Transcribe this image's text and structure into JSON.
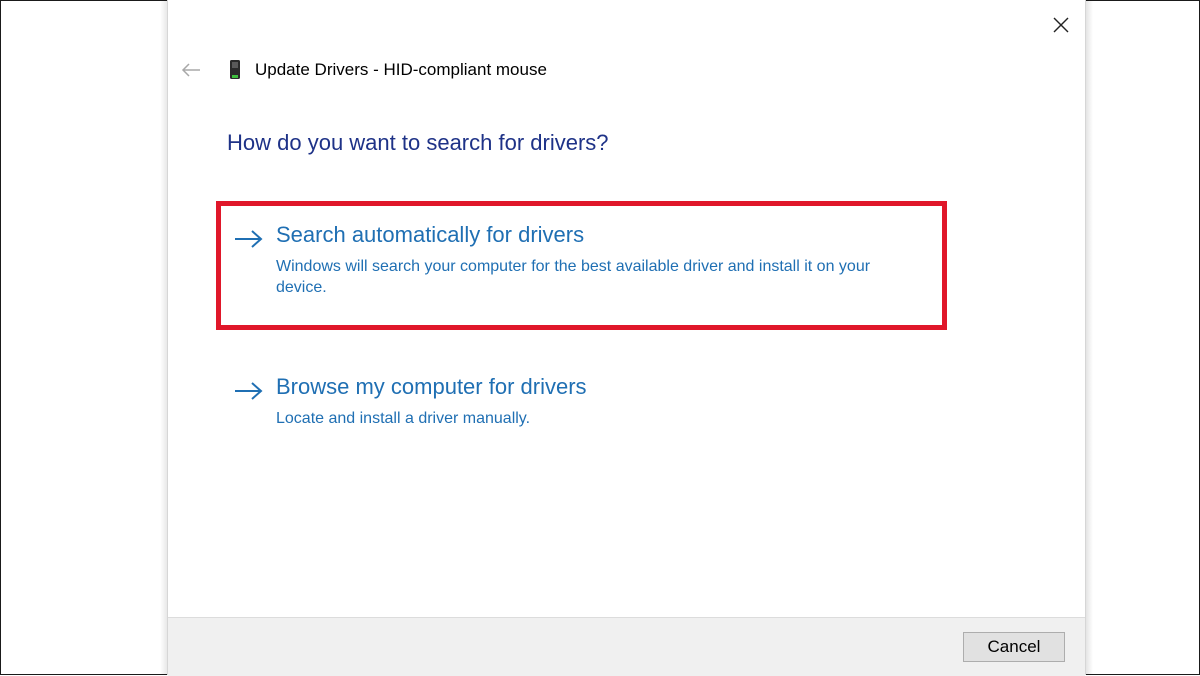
{
  "dialog": {
    "title": "Update Drivers - HID-compliant mouse",
    "heading": "How do you want to search for drivers?",
    "options": [
      {
        "title": "Search automatically for drivers",
        "description": "Windows will search your computer for the best available driver and install it on your device.",
        "highlighted": true,
        "highlight_color": "#e0172a"
      },
      {
        "title": "Browse my computer for drivers",
        "description": "Locate and install a driver manually."
      }
    ],
    "cancel_label": "Cancel",
    "icons": {
      "close": "close-icon",
      "back": "back-arrow-icon",
      "device": "mouse-device-icon",
      "option_arrow": "arrow-right-icon"
    }
  },
  "colors": {
    "heading": "#1e3287",
    "link": "#1f6fb3",
    "highlight": "#e0172a",
    "footer_bg": "#f0f0f0"
  }
}
